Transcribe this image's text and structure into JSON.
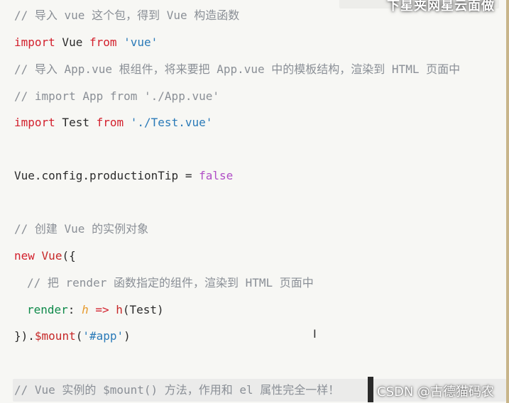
{
  "code": {
    "lines": [
      {
        "tokens": [
          {
            "t": "comment",
            "v": "// 导入 vue 这个包，得到 Vue 构造函数"
          }
        ]
      },
      {
        "tokens": [
          {
            "t": "keyword",
            "v": "import"
          },
          {
            "t": "plain",
            "v": " Vue "
          },
          {
            "t": "keyword",
            "v": "from"
          },
          {
            "t": "plain",
            "v": " "
          },
          {
            "t": "string",
            "v": "'vue'"
          }
        ]
      },
      {
        "tokens": [
          {
            "t": "comment",
            "v": "// 导入 App.vue 根组件，将来要把 App.vue 中的模板结构，渲染到 HTML 页面中"
          }
        ]
      },
      {
        "tokens": [
          {
            "t": "comment",
            "v": "// import App from './App.vue'"
          }
        ]
      },
      {
        "tokens": [
          {
            "t": "keyword",
            "v": "import"
          },
          {
            "t": "plain",
            "v": " Test "
          },
          {
            "t": "keyword",
            "v": "from"
          },
          {
            "t": "plain",
            "v": " "
          },
          {
            "t": "string",
            "v": "'./Test.vue'"
          }
        ]
      },
      {
        "tokens": [
          {
            "t": "plain",
            "v": "Vue.config.productionTip = "
          },
          {
            "t": "bool",
            "v": "false"
          }
        ]
      },
      {
        "tokens": [
          {
            "t": "comment",
            "v": "// 创建 Vue 的实例对象"
          }
        ]
      },
      {
        "tokens": [
          {
            "t": "keyword",
            "v": "new"
          },
          {
            "t": "plain",
            "v": " "
          },
          {
            "t": "fn",
            "v": "Vue"
          },
          {
            "t": "plain",
            "v": "({"
          }
        ]
      },
      {
        "tokens": [
          {
            "t": "comment",
            "v": "// 把 render 函数指定的组件，渲染到 HTML 页面中"
          }
        ]
      },
      {
        "tokens": [
          {
            "t": "prop",
            "v": "render"
          },
          {
            "t": "plain",
            "v": ": "
          },
          {
            "t": "param",
            "v": "h"
          },
          {
            "t": "plain",
            "v": " "
          },
          {
            "t": "keyword",
            "v": "=>"
          },
          {
            "t": "plain",
            "v": " "
          },
          {
            "t": "fn",
            "v": "h"
          },
          {
            "t": "plain",
            "v": "(Test)"
          }
        ]
      },
      {
        "tokens": [
          {
            "t": "plain",
            "v": "})."
          },
          {
            "t": "fn",
            "v": "$mount"
          },
          {
            "t": "plain",
            "v": "("
          },
          {
            "t": "string",
            "v": "'#app'"
          },
          {
            "t": "plain",
            "v": ")"
          }
        ]
      },
      {
        "tokens": [
          {
            "t": "comment",
            "v": "// Vue 实例的 $mount() 方法，作用和 el 属性完全一样！"
          }
        ]
      }
    ]
  },
  "overlay": {
    "top_caption": "下星夹网星云面做",
    "watermark": "CSDN @古德猫码农",
    "cursor_glyph": "I"
  },
  "colors": {
    "background": "#f7f7f4",
    "comment": "#8a8f96",
    "keyword": "#d3212d",
    "string": "#2a7ab8",
    "boolean": "#b04ec6",
    "param": "#e6992a",
    "function": "#c62828",
    "property": "#0f8a4a"
  }
}
